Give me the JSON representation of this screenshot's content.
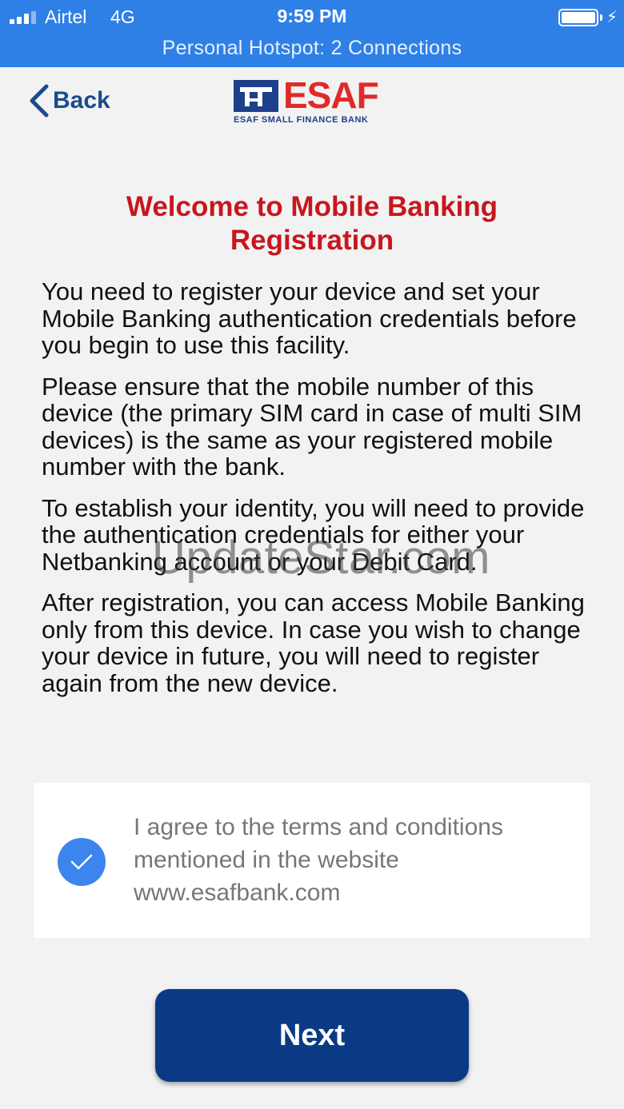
{
  "status_bar": {
    "carrier": "Airtel",
    "network": "4G",
    "time": "9:59 PM",
    "hotspot": "Personal Hotspot: 2 Connections"
  },
  "nav": {
    "back_label": "Back"
  },
  "logo": {
    "wordmark": "ESAF",
    "tagline": "ESAF SMALL FINANCE BANK"
  },
  "title": "Welcome to Mobile Banking Registration",
  "paragraphs": [
    "You need to register your device and set your Mobile Banking authentication credentials before you begin to use this facility.",
    "Please ensure that the mobile number of this device (the primary SIM card in case of multi SIM devices) is the same as your registered mobile number with the bank.",
    "To establish your identity, you will need to provide the authentication credentials for either your Netbanking account or your Debit Card.",
    "After registration, you can access Mobile Banking only from this device. In case you wish to change your device in future, you will need to register again from the new device."
  ],
  "watermark": "UpdateStar.com",
  "agreement": {
    "text": "I agree to the terms and conditions mentioned in the website www.esafbank.com",
    "checked": true
  },
  "next_button": "Next",
  "colors": {
    "status_bar": "#2f80e6",
    "title": "#c8161e",
    "button": "#0b3a85",
    "checkbox": "#3d85ee"
  }
}
